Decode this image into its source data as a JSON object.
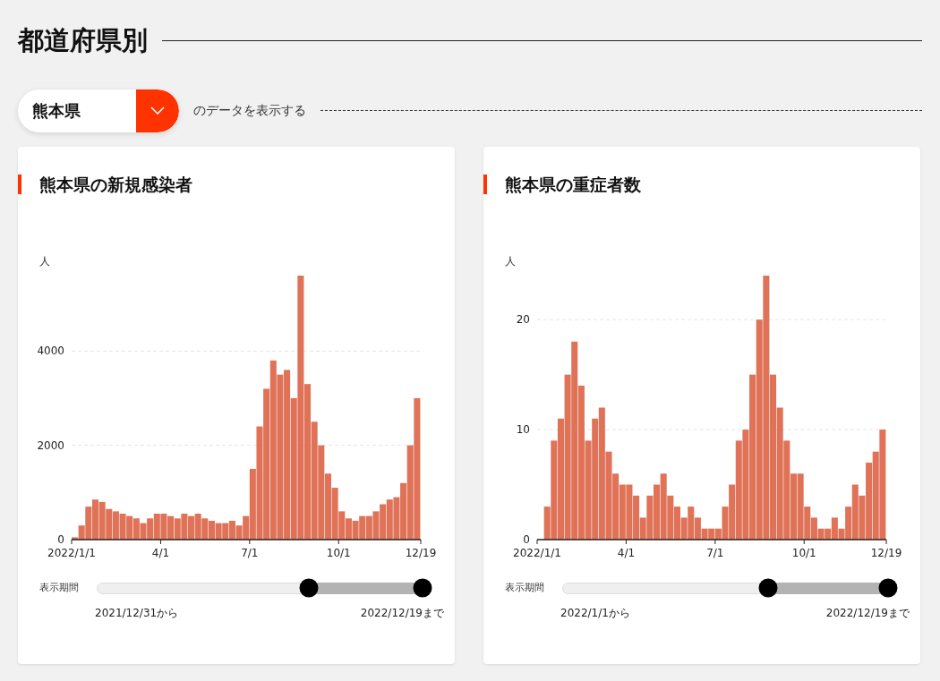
{
  "section_title": "都道府県別",
  "selector": {
    "value": "熊本県",
    "suffix": "のデータを表示する"
  },
  "cards": [
    {
      "title": "熊本県の新規感染者",
      "chart_data": {
        "type": "bar",
        "ylabel": "人",
        "categories": [
          "2022/1/1",
          null,
          null,
          null,
          null,
          null,
          null,
          null,
          null,
          null,
          null,
          null,
          null,
          "4/1",
          null,
          null,
          null,
          null,
          null,
          null,
          null,
          null,
          null,
          null,
          null,
          null,
          "7/1",
          null,
          null,
          null,
          null,
          null,
          null,
          null,
          null,
          null,
          null,
          null,
          null,
          "10/1",
          null,
          null,
          null,
          null,
          null,
          null,
          null,
          null,
          null,
          null,
          "12/19"
        ],
        "ylim": [
          0,
          5600
        ],
        "yticks": [
          0,
          2000,
          4000
        ],
        "series": [
          {
            "color": "#df7257",
            "values": [
              50,
              300,
              700,
              850,
              800,
              650,
              600,
              550,
              500,
              450,
              350,
              450,
              550,
              550,
              500,
              450,
              550,
              500,
              550,
              450,
              400,
              350,
              350,
              400,
              300,
              500,
              1500,
              2400,
              3200,
              3800,
              3500,
              3600,
              3000,
              5600,
              3300,
              2500,
              2000,
              1400,
              1100,
              600,
              450,
              400,
              500,
              500,
              600,
              750,
              850,
              900,
              1200,
              2000,
              3000
            ]
          }
        ]
      },
      "slider": {
        "label": "表示期間",
        "start": {
          "level": 0.65
        },
        "end": {
          "level": 1
        },
        "from_text": "2021/12/31から",
        "to_text": "2022/12/19まで"
      }
    },
    {
      "title": "熊本県の重症者数",
      "chart_data": {
        "type": "bar",
        "ylabel": "人",
        "categories": [
          "2022/1/1",
          null,
          null,
          null,
          null,
          null,
          null,
          null,
          null,
          null,
          null,
          null,
          null,
          "4/1",
          null,
          null,
          null,
          null,
          null,
          null,
          null,
          null,
          null,
          null,
          null,
          null,
          "7/1",
          null,
          null,
          null,
          null,
          null,
          null,
          null,
          null,
          null,
          null,
          null,
          null,
          "10/1",
          null,
          null,
          null,
          null,
          null,
          null,
          null,
          null,
          null,
          null,
          "12/19"
        ],
        "ylim": [
          0,
          24
        ],
        "yticks": [
          0,
          10,
          20
        ],
        "series": [
          {
            "color": "#df7257",
            "values": [
              0,
              3,
              9,
              11,
              15,
              18,
              14,
              9,
              11,
              12,
              8,
              6,
              5,
              5,
              4,
              2,
              4,
              5,
              6,
              4,
              3,
              2,
              3,
              2,
              1,
              1,
              1,
              3,
              5,
              9,
              10,
              15,
              20,
              24,
              15,
              12,
              9,
              6,
              6,
              3,
              2,
              1,
              1,
              2,
              1,
              3,
              5,
              4,
              7,
              8,
              10
            ]
          }
        ]
      },
      "slider": {
        "label": "表示期間",
        "start": {
          "level": 0.63
        },
        "end": {
          "level": 1
        },
        "from_text": "2022/1/1から",
        "to_text": "2022/12/19まで"
      }
    }
  ]
}
